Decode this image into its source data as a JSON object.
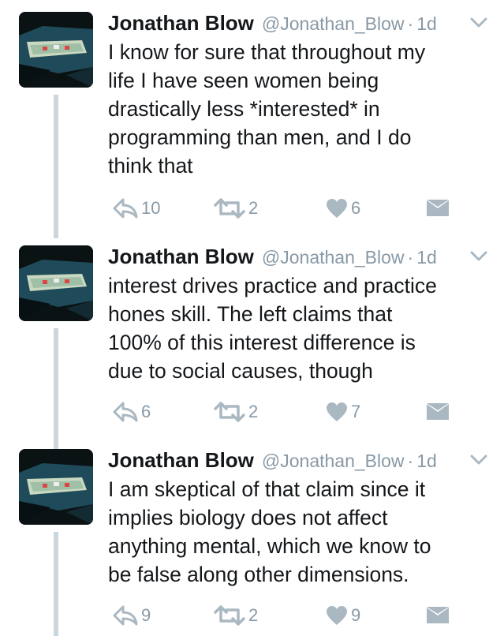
{
  "colors": {
    "text": "#14171a",
    "muted": "#8899a6",
    "thread_line": "#ccd6dd",
    "icon": "#aab8c2"
  },
  "tweets": [
    {
      "name": "Jonathan Blow",
      "handle": "@Jonathan_Blow",
      "separator": "·",
      "time": "1d",
      "text": "I know for sure that throughout my\nlife I have seen women being\ndrastically less *interested* in\nprogramming than men, and I do\nthink that",
      "replies": "10",
      "retweets": "2",
      "likes": "6"
    },
    {
      "name": "Jonathan Blow",
      "handle": "@Jonathan_Blow",
      "separator": "·",
      "time": "1d",
      "text": "interest drives practice and practice\nhones skill. The left claims that\n100% of this interest difference is\ndue to social causes, though",
      "replies": "6",
      "retweets": "2",
      "likes": "7"
    },
    {
      "name": "Jonathan Blow",
      "handle": "@Jonathan_Blow",
      "separator": "·",
      "time": "1d",
      "text": "I am skeptical of that claim since it\nimplies biology does not affect\nanything mental, which we know to\nbe false along other dimensions.",
      "replies": "9",
      "retweets": "2",
      "likes": "9"
    }
  ]
}
